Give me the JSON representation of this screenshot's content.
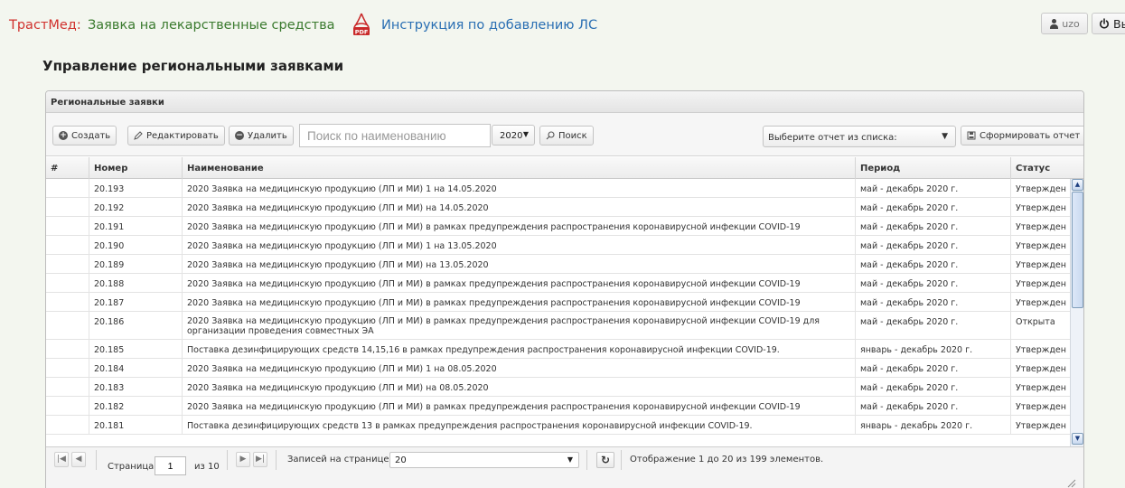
{
  "header": {
    "brand": "ТрастМед:",
    "app_title": "Заявка на лекарственные средства",
    "instruction_link": "Инструкция по добавлению ЛС",
    "pdf_badge": "PDF",
    "user": "uzo",
    "logout": "Выход"
  },
  "page": {
    "title": "Управление региональными заявками"
  },
  "panel": {
    "title": "Региональные заявки"
  },
  "toolbar": {
    "create": "Создать",
    "edit": "Редактировать",
    "delete": "Удалить",
    "search_placeholder": "Поиск по наименованию",
    "year": "2020",
    "search": "Поиск",
    "report_placeholder": "Выберите отчет из списка:",
    "build_report": "Сформировать отчет"
  },
  "table": {
    "columns": [
      "#",
      "Номер",
      "Наименование",
      "Период",
      "Статус"
    ],
    "rows": [
      {
        "num": "20.193",
        "name": "2020 Заявка на медицинскую продукцию (ЛП и МИ) 1 на 14.05.2020",
        "period": "май - декабрь 2020 г.",
        "status": "Утвержден"
      },
      {
        "num": "20.192",
        "name": "2020 Заявка на медицинскую продукцию (ЛП и МИ) на 14.05.2020",
        "period": "май - декабрь 2020 г.",
        "status": "Утвержден"
      },
      {
        "num": "20.191",
        "name": "2020 Заявка на медицинскую продукцию (ЛП и МИ) в рамках предупреждения распространения коронавирусной инфекции COVID-19",
        "period": "май - декабрь 2020 г.",
        "status": "Утвержден"
      },
      {
        "num": "20.190",
        "name": "2020 Заявка на медицинскую продукцию (ЛП и МИ) 1 на 13.05.2020",
        "period": "май - декабрь 2020 г.",
        "status": "Утвержден"
      },
      {
        "num": "20.189",
        "name": "2020 Заявка на медицинскую продукцию (ЛП и МИ) на 13.05.2020",
        "period": "май - декабрь 2020 г.",
        "status": "Утвержден"
      },
      {
        "num": "20.188",
        "name": "2020 Заявка на медицинскую продукцию (ЛП и МИ) в рамках предупреждения распространения коронавирусной инфекции COVID-19",
        "period": "май - декабрь 2020 г.",
        "status": "Утвержден"
      },
      {
        "num": "20.187",
        "name": "2020 Заявка на медицинскую продукцию (ЛП и МИ) в рамках предупреждения распространения коронавирусной инфекции COVID-19",
        "period": "май - декабрь 2020 г.",
        "status": "Утвержден"
      },
      {
        "num": "20.186",
        "name": "2020 Заявка на медицинскую продукцию (ЛП и МИ) в рамках предупреждения распространения коронавирусной инфекции COVID-19 для организации проведения совместных ЭА",
        "period": "май - декабрь 2020 г.",
        "status": "Открыта"
      },
      {
        "num": "20.185",
        "name": "Поставка дезинфицирующих средств 14,15,16 в рамках предупреждения распространения коронавирусной инфекции COVID-19.",
        "period": "январь - декабрь 2020 г.",
        "status": "Утвержден"
      },
      {
        "num": "20.184",
        "name": "2020 Заявка на медицинскую продукцию (ЛП и МИ) 1 на 08.05.2020",
        "period": "май - декабрь 2020 г.",
        "status": "Утвержден"
      },
      {
        "num": "20.183",
        "name": "2020 Заявка на медицинскую продукцию (ЛП и МИ) на 08.05.2020",
        "period": "май - декабрь 2020 г.",
        "status": "Утвержден"
      },
      {
        "num": "20.182",
        "name": "2020 Заявка на медицинскую продукцию (ЛП и МИ) в рамках предупреждения распространения коронавирусной инфекции COVID-19",
        "period": "май - декабрь 2020 г.",
        "status": "Утвержден"
      },
      {
        "num": "20.181",
        "name": "Поставка дезинфицирующих средств 13 в рамках предупреждения распространения коронавирусной инфекции COVID-19.",
        "period": "январь - декабрь 2020 г.",
        "status": "Утвержден"
      }
    ]
  },
  "pager": {
    "page_label": "Страница",
    "page_value": "1",
    "of_label": "из 10",
    "per_page_label": "Записей на странице:",
    "per_page_value": "20",
    "summary": "Отображение 1 до 20 из 199 элементов."
  }
}
